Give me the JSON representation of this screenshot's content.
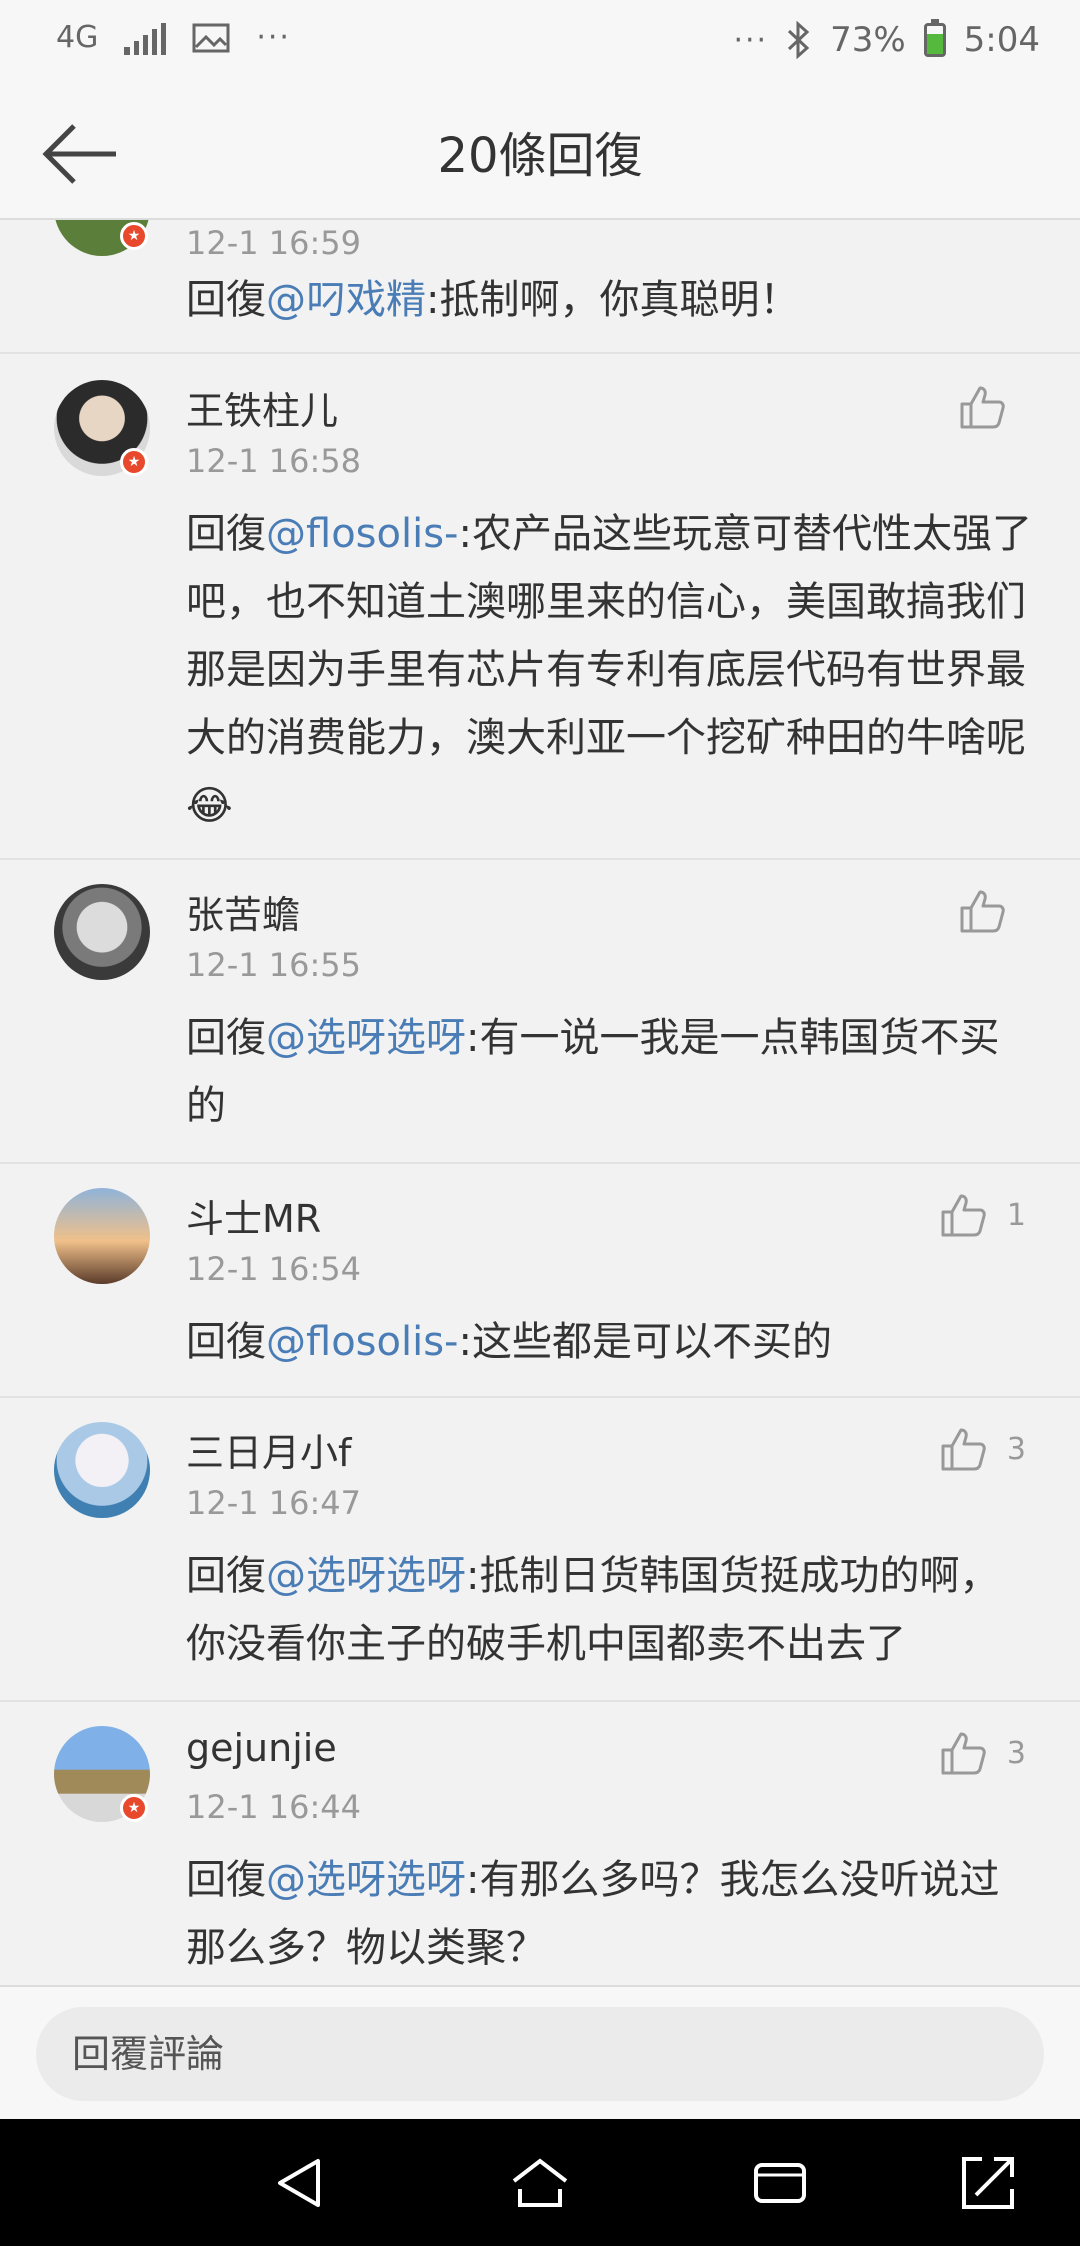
{
  "status": {
    "network": "4G",
    "battery": "73%",
    "time": "5:04"
  },
  "header": {
    "title": "20條回復"
  },
  "comments": [
    {
      "name": "",
      "time": "12-1 16:59",
      "reply_prefix": "回復",
      "mention": "@叼戏精",
      "text": ":抵制啊，你真聪明！",
      "likes": ""
    },
    {
      "name": "王铁柱儿",
      "time": "12-1 16:58",
      "reply_prefix": "回復",
      "mention": "@flosolis-",
      "text": ":农产品这些玩意可替代性太强了吧，也不知道土澳哪里来的信心，美国敢搞我们那是因为手里有芯片有专利有底层代码有世界最大的消费能力，澳大利亚一个挖矿种田的牛啥呢😂",
      "likes": ""
    },
    {
      "name": "张苦蟾",
      "time": "12-1 16:55",
      "reply_prefix": "回復",
      "mention": "@选呀选呀",
      "text": ":有一说一我是一点韩国货不买的",
      "likes": ""
    },
    {
      "name": "斗士MR",
      "time": "12-1 16:54",
      "reply_prefix": "回復",
      "mention": "@flosolis-",
      "text": ":这些都是可以不买的",
      "likes": "1"
    },
    {
      "name": "三日月小f",
      "time": "12-1 16:47",
      "reply_prefix": "回復",
      "mention": "@选呀选呀",
      "text": ":抵制日货韩国货挺成功的啊，你没看你主子的破手机中国都卖不出去了",
      "likes": "3"
    },
    {
      "name": "gejunjie",
      "time": "12-1 16:44",
      "reply_prefix": "回復",
      "mention": "@选呀选呀",
      "text": ":有那么多吗？我怎么没听说过那么多？物以类聚？",
      "likes": "3"
    }
  ],
  "reply": {
    "placeholder": "回覆評論"
  },
  "colors": {
    "mention": "#4a7cb6",
    "badge": "#e8482b",
    "background": "#f2f2f2"
  }
}
